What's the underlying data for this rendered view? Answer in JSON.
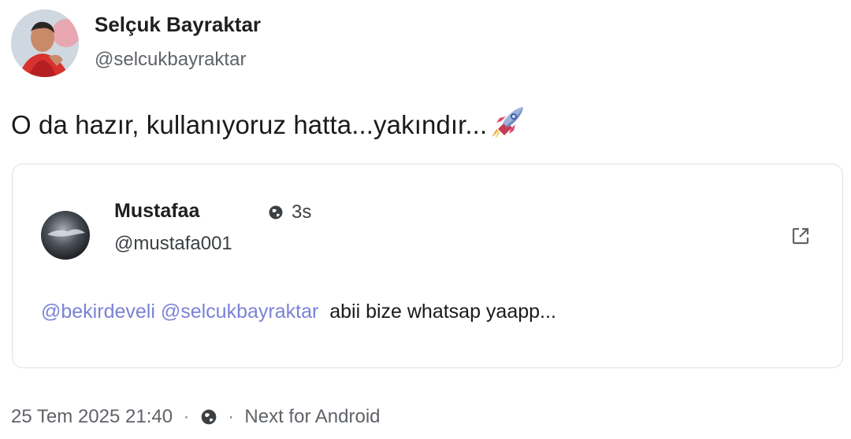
{
  "post": {
    "author_name": "Selçuk Bayraktar",
    "author_handle": "@selcukbayraktar",
    "text": "O da hazır, kullanıyoruz hatta...yakındır...",
    "emoji_icon": "rocket-icon"
  },
  "quote": {
    "author_name": "Mustafaa",
    "author_handle": "@mustafa001",
    "time_ago": "3s",
    "mentions": [
      "@bekirdeveli",
      "@selcukbayraktar"
    ],
    "text": "abii bize whatsap yaapp..."
  },
  "meta": {
    "timestamp": "25 Tem 2025 21:40",
    "separator": "·",
    "client": "Next for Android"
  },
  "colors": {
    "mention": "#7b82d6",
    "border": "#dcdfe4",
    "muted": "#5f6368"
  }
}
